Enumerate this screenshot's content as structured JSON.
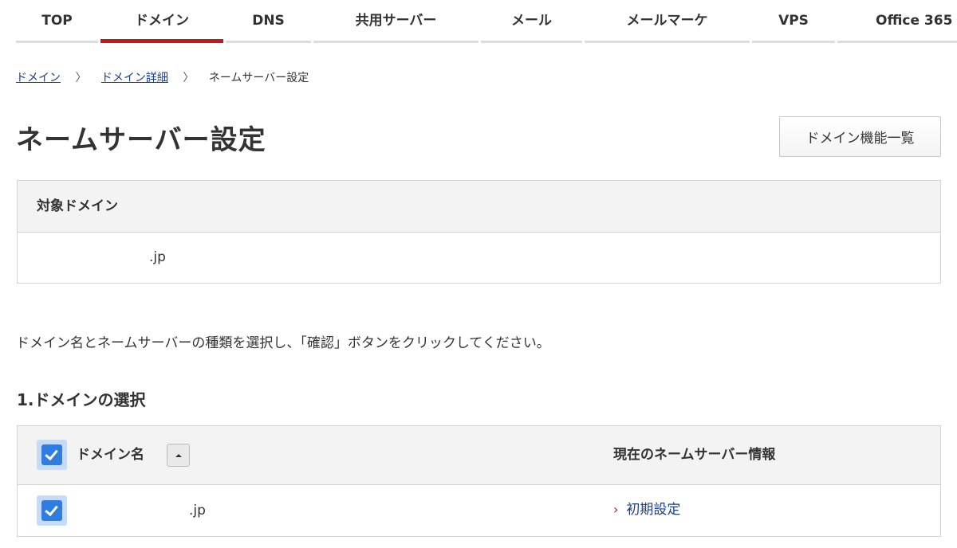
{
  "nav": {
    "items": [
      {
        "label": "TOP"
      },
      {
        "label": "ドメイン"
      },
      {
        "label": "DNS"
      },
      {
        "label": "共用サーバー"
      },
      {
        "label": "メール"
      },
      {
        "label": "メールマーケ"
      },
      {
        "label": "VPS"
      },
      {
        "label": "Office 365"
      }
    ],
    "active_index": 1,
    "active_color": "#c8161d"
  },
  "breadcrumb": {
    "items": [
      "ドメイン",
      "ドメイン詳細"
    ],
    "current": "ネームサーバー設定",
    "separator": "〉"
  },
  "page": {
    "title": "ネームサーバー設定",
    "function_button": "ドメイン機能一覧"
  },
  "target": {
    "header": "対象ドメイン",
    "value": ".jp"
  },
  "instruction": "ドメイン名とネームサーバーの種類を選択し、「確認」ボタンをクリックしてください。",
  "section": {
    "title": "1.ドメインの選択"
  },
  "table": {
    "headers": {
      "domain": "ドメイン名",
      "nameserver": "現在のネームサーバー情報"
    },
    "rows": [
      {
        "domain": ".jp",
        "nameserver": "初期設定",
        "checked": true
      }
    ],
    "select_all_checked": true,
    "sort_icon": "sort-asc-icon",
    "link_chevron": "›"
  }
}
